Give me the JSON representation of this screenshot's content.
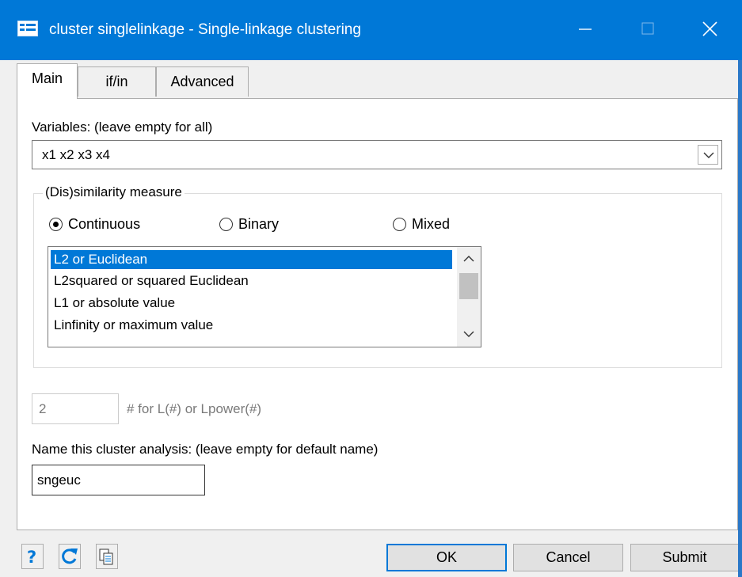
{
  "window": {
    "title": "cluster singlelinkage - Single-linkage clustering",
    "accent_color": "#0078d7",
    "controls": [
      "minimize-icon",
      "maximize-icon",
      "close-icon"
    ]
  },
  "tabs": [
    {
      "label": "Main",
      "active": true
    },
    {
      "label": "if/in",
      "active": false
    },
    {
      "label": "Advanced",
      "active": false
    }
  ],
  "variables": {
    "label": "Variables: (leave empty for all)",
    "value": "x1 x2 x3 x4"
  },
  "measure": {
    "group_label": "(Dis)similarity measure",
    "radios": [
      {
        "label": "Continuous",
        "selected": true
      },
      {
        "label": "Binary",
        "selected": false
      },
      {
        "label": "Mixed",
        "selected": false
      }
    ],
    "list": [
      "L2 or Euclidean",
      "L2squared or squared Euclidean",
      "L1 or absolute value",
      "Linfinity or maximum value"
    ],
    "selected_index": 0
  },
  "power": {
    "value": "2",
    "label": "# for L(#) or Lpower(#)"
  },
  "name": {
    "label": "Name this cluster analysis:  (leave empty for default name)",
    "value": "sngeuc"
  },
  "footer": {
    "icons": [
      "help-icon",
      "reset-icon",
      "copy-icon"
    ],
    "ok": "OK",
    "cancel": "Cancel",
    "submit": "Submit"
  }
}
